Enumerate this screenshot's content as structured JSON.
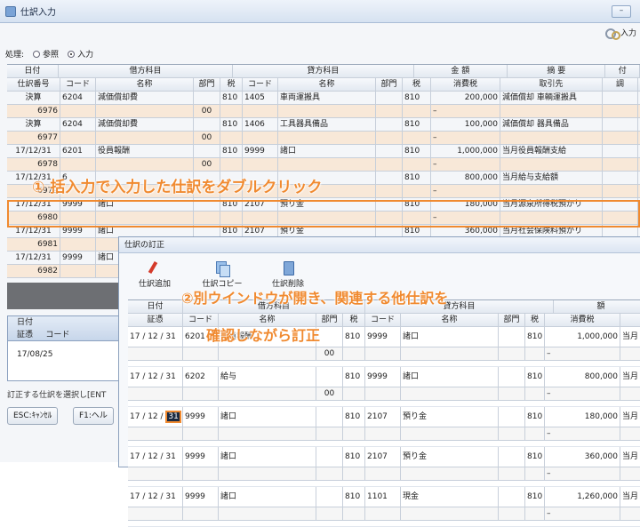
{
  "window": {
    "title": "仕訳入力",
    "minimize": "–",
    "toolbar_input": "入力"
  },
  "process": {
    "label": "処理:",
    "options": [
      "参照",
      "入力"
    ],
    "selected": "入力"
  },
  "grid": {
    "headers_top": [
      "日付",
      "借方科目",
      "貸方科目",
      "金 額",
      "摘 要",
      "付"
    ],
    "headers_sub": [
      "仕訳番号",
      "コード",
      "名称",
      "部門",
      "税",
      "コード",
      "名称",
      "部門",
      "税",
      "消費税",
      "取引先",
      "調"
    ],
    "rows": [
      {
        "date": "決算",
        "dcode": "6204",
        "dname": "減価償却費",
        "dtax": "810",
        "ccode": "1405",
        "cname": "車両運搬具",
        "ctax": "810",
        "amount": "200,000",
        "desc": "減価償却 車輌運搬具",
        "no": "6976",
        "dept": "00",
        "tax2": "–"
      },
      {
        "date": "決算",
        "dcode": "6204",
        "dname": "減価償却費",
        "dtax": "810",
        "ccode": "1406",
        "cname": "工具器具備品",
        "ctax": "810",
        "amount": "100,000",
        "desc": "減価償却 器具備品",
        "no": "6977",
        "dept": "00",
        "tax2": "–"
      },
      {
        "date": "17/12/31",
        "dcode": "6201",
        "dname": "役員報酬",
        "dtax": "810",
        "ccode": "9999",
        "cname": "諸口",
        "ctax": "810",
        "amount": "1,000,000",
        "desc": "当月役員報酬支給",
        "no": "6978",
        "dept": "00",
        "tax2": "–"
      },
      {
        "date": "17/12/31",
        "dcode": "6",
        "dname": "",
        "dtax": "",
        "ccode": "",
        "cname": "",
        "ctax": "810",
        "amount": "800,000",
        "desc": "当月給与支給額",
        "no": "6979",
        "dept": "",
        "tax2": "–"
      },
      {
        "date": "17/12/31",
        "dcode": "9999",
        "dname": "諸口",
        "dtax": "810",
        "ccode": "2107",
        "cname": "預り金",
        "ctax": "810",
        "amount": "180,000",
        "desc": "当月源泉所得税預かり",
        "no": "6980",
        "dept": "",
        "tax2": "–"
      },
      {
        "date": "17/12/31",
        "dcode": "9999",
        "dname": "諸口",
        "dtax": "810",
        "ccode": "2107",
        "cname": "預り金",
        "ctax": "810",
        "amount": "360,000",
        "desc": "当月社会保険料預かり",
        "no": "6981",
        "dept": "",
        "tax2": ""
      },
      {
        "date": "17/12/31",
        "dcode": "9999",
        "dname": "諸口",
        "dtax": "",
        "ccode": "",
        "cname": "",
        "ctax": "",
        "amount": "",
        "desc": "",
        "no": "6982",
        "dept": "",
        "tax2": ""
      }
    ]
  },
  "lower_panel": {
    "header1": "日付",
    "header2a": "証憑",
    "header2b": "コード",
    "date": "17/08/25"
  },
  "status": "訂正する仕訳を選択し[ENT",
  "footer": {
    "esc": "ESC:ｷｬﾝｾﾙ",
    "f1": "F1:ヘル"
  },
  "popup": {
    "title": "仕訳の訂正",
    "tools": [
      "仕訳追加",
      "仕訳コピー",
      "仕訳削除"
    ],
    "headers_top": [
      "日付",
      "借方科目",
      "貸方科目",
      "額"
    ],
    "headers_sub": [
      "証憑",
      "コード",
      "名称",
      "部門",
      "税",
      "コード",
      "名称",
      "部門",
      "税",
      "消費税"
    ],
    "entries": [
      {
        "date": "17 / 12 / 31",
        "dcode": "6201",
        "dname": "役員報酬",
        "dtax": "810",
        "ccode": "9999",
        "cname": "諸口",
        "ctax": "810",
        "amount": "1,000,000",
        "tail": "当月",
        "dept": "00",
        "sub": "–"
      },
      {
        "date": "17 / 12 / 31",
        "dcode": "6202",
        "dname": "給与",
        "dtax": "810",
        "ccode": "9999",
        "cname": "諸口",
        "ctax": "810",
        "amount": "800,000",
        "tail": "当月",
        "dept": "00",
        "sub": "–"
      },
      {
        "date_a": "17 / 12 / ",
        "date_b": "31",
        "dcode": "9999",
        "dname": "諸口",
        "dtax": "810",
        "ccode": "2107",
        "cname": "預り金",
        "ctax": "810",
        "amount": "180,000",
        "tail": "当月",
        "dept": "",
        "sub": "–"
      },
      {
        "date": "17 / 12 / 31",
        "dcode": "9999",
        "dname": "諸口",
        "dtax": "810",
        "ccode": "2107",
        "cname": "預り金",
        "ctax": "810",
        "amount": "360,000",
        "tail": "当月",
        "dept": "",
        "sub": "–"
      },
      {
        "date": "17 / 12 / 31",
        "dcode": "9999",
        "dname": "諸口",
        "dtax": "810",
        "ccode": "1101",
        "cname": "現金",
        "ctax": "810",
        "amount": "1,260,000",
        "tail": "当月",
        "dept": "",
        "sub": "–"
      }
    ]
  },
  "annotations": {
    "a1_num": "①",
    "a1": "括入力で入力した仕訳をダブルクリック",
    "a2_line1": "②別ウインドウが開き、関連する他仕訳を",
    "a2_line2": "確認しながら訂正"
  },
  "colors": {
    "accent": "#f08a30",
    "subrow": "#f8e8d8"
  }
}
